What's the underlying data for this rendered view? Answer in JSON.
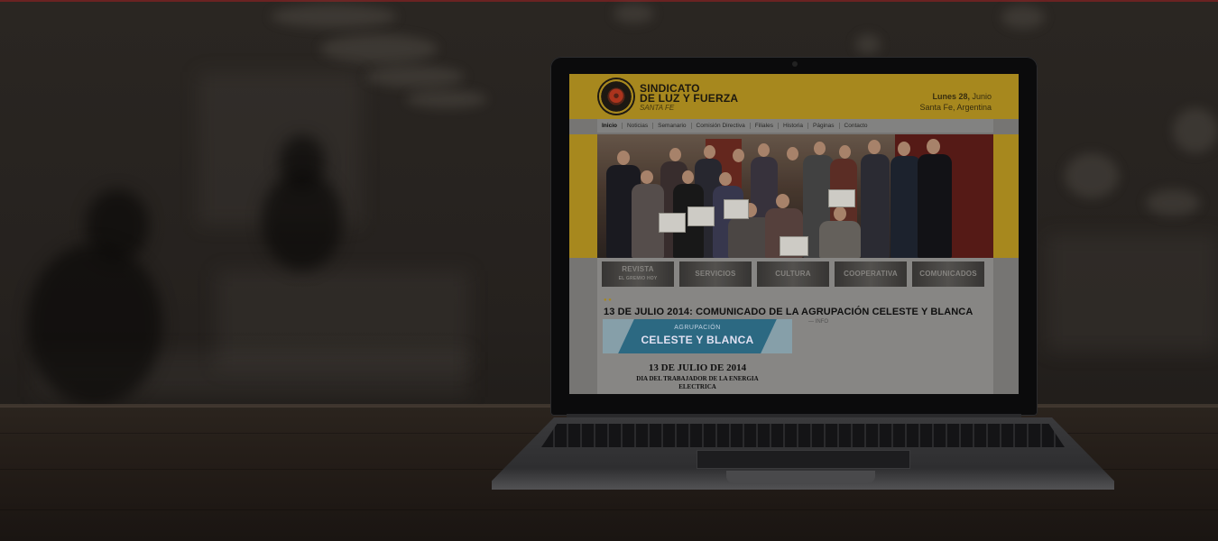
{
  "site": {
    "name_line1": "SINDICATO",
    "name_line2": "DE LUZ Y FUERZA",
    "subtitle": "SANTA FE",
    "date_day": "Lunes 28,",
    "date_month": "Junio",
    "location": "Santa Fe, Argentina"
  },
  "nav": {
    "items": [
      "Inicio",
      "Noticias",
      "Semanario",
      "Comisión Directiva",
      "Filiales",
      "Historia",
      "Páginas",
      "Contacto"
    ],
    "active": "Inicio"
  },
  "tiles": {
    "revista": "REVISTA",
    "revista_sub": "EL GREMIO HOY",
    "servicios": "SERVICIOS",
    "cultura": "CULTURA",
    "cooperativa": "COOPERATIVA",
    "comunicados": "COMUNICADOS"
  },
  "post": {
    "title": "13 DE JULIO 2014: COMUNICADO DE LA AGRUPACIÓN CELESTE Y BLANCA",
    "meta": "— INFO",
    "banner_small": "AGRUPACIÓN",
    "banner_big": "CELESTE Y BLANCA",
    "letter_date": "13 DE JULIO DE 2014",
    "letter_sub_1": "DIA DEL TRABAJADOR DE LA ENERGIA",
    "letter_sub_2": "ELECTRICA"
  },
  "colors": {
    "header_gold": "#b09020",
    "banner_blue": "#2f6f8a"
  },
  "icons": {
    "logo": "gear-emblem-icon",
    "camera": "webcam-icon"
  }
}
